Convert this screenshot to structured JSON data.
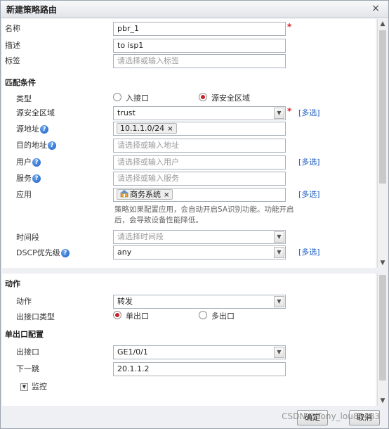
{
  "dialog": {
    "title": "新建策略路由",
    "close_symbol": "×"
  },
  "basic": {
    "name_label": "名称",
    "name_value": "pbr_1",
    "desc_label": "描述",
    "desc_value": "to isp1",
    "tag_label": "标签",
    "tag_placeholder": "请选择或输入标签"
  },
  "match": {
    "section_title": "匹配条件",
    "type_label": "类型",
    "type_options": [
      "入接口",
      "源安全区域"
    ],
    "type_selected": "源安全区域",
    "src_zone_label": "源安全区域",
    "src_zone_value": "trust",
    "multi_select": "[多选]",
    "src_addr_label": "源地址",
    "src_addr_tag": "10.1.1.0/24",
    "dst_addr_label": "目的地址",
    "dst_addr_placeholder": "请选择或输入地址",
    "user_label": "用户",
    "user_placeholder": "请选择或输入用户",
    "service_label": "服务",
    "service_placeholder": "请选择或输入服务",
    "app_label": "应用",
    "app_tag": "商务系统",
    "app_note": "策略如果配置应用，会自动开启SA识别功能。功能开启后，会导致设备性能降低。",
    "time_label": "时间段",
    "time_placeholder": "请选择时间段",
    "dscp_label": "DSCP优先级",
    "dscp_value": "any",
    "help_symbol": "?",
    "remove_symbol": "×"
  },
  "action": {
    "section_title": "动作",
    "action_label": "动作",
    "action_value": "转发",
    "out_type_label": "出接口类型",
    "out_type_options": [
      "单出口",
      "多出口"
    ],
    "out_type_selected": "单出口"
  },
  "single_out": {
    "section_title": "单出口配置",
    "out_if_label": "出接口",
    "out_if_value": "GE1/0/1",
    "next_hop_label": "下一跳",
    "next_hop_value": "20.1.1.2",
    "monitor_label": "监控"
  },
  "footer": {
    "ok_label": "确定",
    "cancel_label": "取消",
    "watermark": "CSDN @Tony_lou83483"
  },
  "colors": {
    "required": "#d9232d",
    "link": "#1f5fbf",
    "radio_selected": "#c8222a"
  }
}
